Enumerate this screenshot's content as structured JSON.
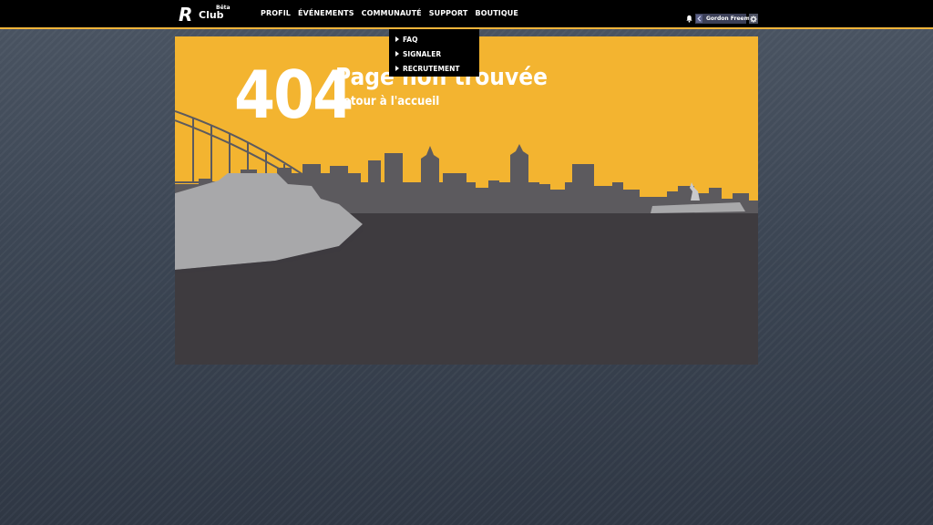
{
  "header": {
    "logo_letter": "R",
    "logo_name": "Club",
    "logo_badge": "Bêta",
    "nav": [
      {
        "label": "PROFIL"
      },
      {
        "label": "ÉVÉNEMENTS"
      },
      {
        "label": "COMMUNAUTÉ"
      },
      {
        "label": "SUPPORT"
      },
      {
        "label": "BOUTIQUE"
      }
    ],
    "user_name": "Gordon Freeman",
    "icons": [
      "bell-icon",
      "avatar",
      "gear-icon"
    ]
  },
  "dropdown": {
    "items": [
      {
        "label": "FAQ"
      },
      {
        "label": "SIGNALER"
      },
      {
        "label": "RECRUTEMENT"
      }
    ]
  },
  "error": {
    "code": "404",
    "title": "Page non trouvée",
    "home_link": "Retour à l'accueil"
  },
  "colors": {
    "accent": "#f3b430",
    "skyline": "#5c5a5e",
    "water": "#3e3b3f",
    "ship": "#a8a8aa",
    "topbar": "#000000"
  }
}
